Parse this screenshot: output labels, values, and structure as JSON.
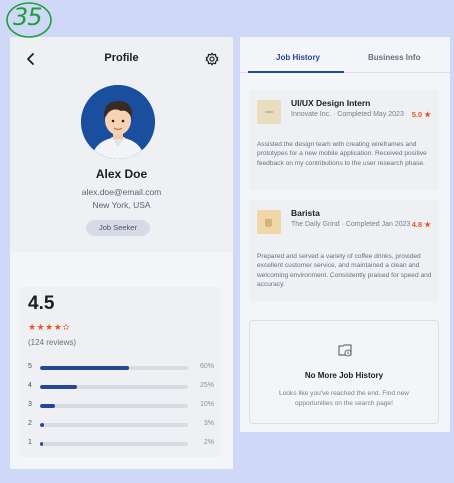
{
  "annotation": {
    "label": "35"
  },
  "profile": {
    "title": "Profile",
    "name": "Alex Doe",
    "email": "alex.doe@email.com",
    "location": "New York, USA",
    "role": "Job Seeker"
  },
  "rating": {
    "value": "4.5",
    "stars": "★★★★✫",
    "reviews": "(124 reviews)",
    "distribution": [
      {
        "star": "5",
        "pct": "60%",
        "fraction": 0.6
      },
      {
        "star": "4",
        "pct": "25%",
        "fraction": 0.25
      },
      {
        "star": "3",
        "pct": "10%",
        "fraction": 0.1
      },
      {
        "star": "2",
        "pct": "3%",
        "fraction": 0.03
      },
      {
        "star": "1",
        "pct": "2%",
        "fraction": 0.02
      }
    ]
  },
  "tabs": {
    "job_history": "Job History",
    "business_info": "Business Info"
  },
  "jobs": [
    {
      "title": "UI/UX Design Intern",
      "sub": "Innovate Inc. · Completed May 2023",
      "rating": "5.0 ★",
      "desc": "Assisted the design team with creating wireframes and prototypes for a new mobile application. Received positive feedback on my contributions to the user research phase.",
      "logo_color": "#e8ddbf"
    },
    {
      "title": "Barista",
      "sub": "The Daily Grind · Completed Jan 2023",
      "rating": "4.8 ★",
      "desc": "Prepared and served a variety of coffee drinks, provided excellent customer service, and maintained a clean and welcoming environment. Consistently praised for speed and accuracy.",
      "logo_color": "#efd7a8"
    }
  ],
  "end": {
    "title": "No More Job History",
    "text": "Looks like you've reached the end. Find new opportunities on the search page!"
  },
  "colors": {
    "accent": "#25479a",
    "star": "#e8572a",
    "annotation": "#1f9f3a"
  }
}
